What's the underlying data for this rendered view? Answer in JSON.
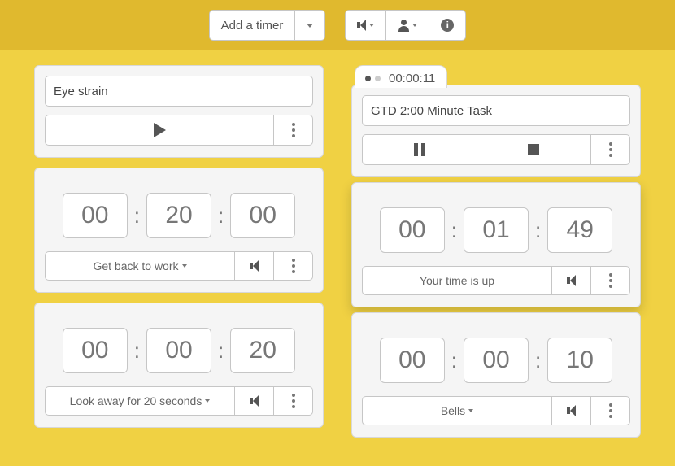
{
  "topbar": {
    "add_timer_label": "Add a timer",
    "volume_icon": "volume-icon",
    "user_icon": "user-icon",
    "info_icon": "info-icon"
  },
  "left": {
    "title": "Eye strain",
    "hours": "00",
    "minutes": "20",
    "seconds": "00",
    "message": "Get back to work",
    "rest_hours": "00",
    "rest_minutes": "00",
    "rest_seconds": "20",
    "rest_message": "Look away for 20 seconds"
  },
  "right": {
    "running": true,
    "elapsed": "00:00:11",
    "title": "GTD 2:00 Minute Task",
    "hours": "00",
    "minutes": "01",
    "seconds": "49",
    "message": "Your time is up",
    "next_hours": "00",
    "next_minutes": "00",
    "next_seconds": "10",
    "next_message": "Bells"
  }
}
